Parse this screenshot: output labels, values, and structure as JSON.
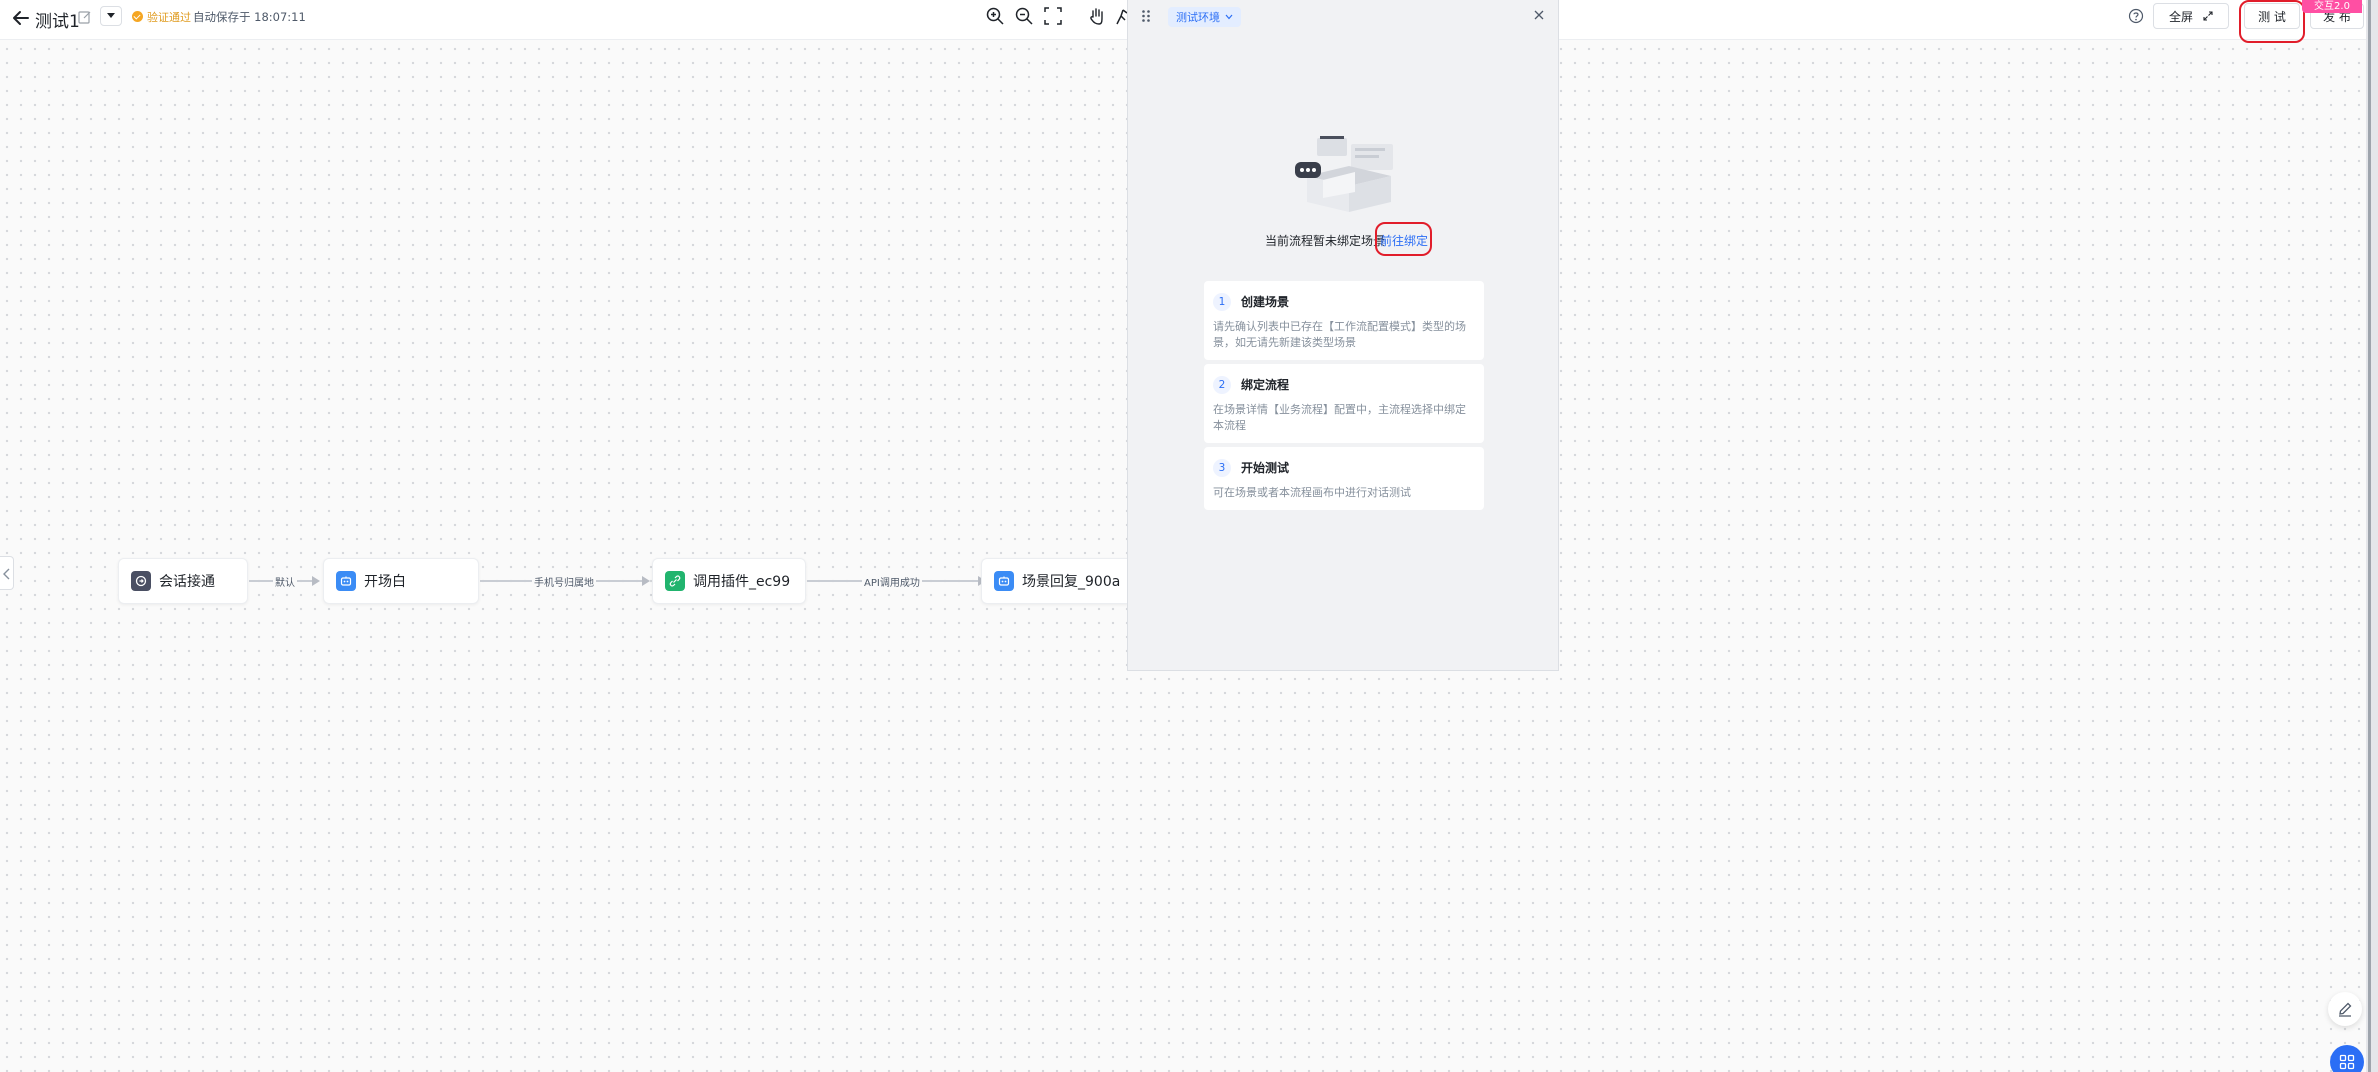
{
  "header": {
    "title": "测试1",
    "validation_status": "验证通过",
    "autosave_text": "自动保存于 18:07:11",
    "fullscreen_label": "全屏",
    "test_label": "测 试",
    "publish_label": "发 布",
    "corner_badge": "交互2.0"
  },
  "toolbar": {
    "icons": [
      "zoom-in-icon",
      "zoom-out-icon",
      "fit-view-icon",
      "hand-icon",
      "run-icon"
    ]
  },
  "flow": {
    "nodes": [
      {
        "label": "会话接通",
        "icon": "session-icon",
        "color": "#4a4f63"
      },
      {
        "label": "开场白",
        "icon": "robot-icon",
        "color": "#3b8cf5"
      },
      {
        "label": "调用插件_ec99",
        "icon": "plugin-icon",
        "color": "#21b46e"
      },
      {
        "label": "场景回复_900a",
        "icon": "robot-icon",
        "color": "#3b8cf5"
      }
    ],
    "edges": [
      {
        "label": "默认"
      },
      {
        "label": "手机号归属地"
      },
      {
        "label": "API调用成功"
      }
    ]
  },
  "test_panel": {
    "env_label": "测试环境",
    "empty_text": "当前流程暂未绑定场景",
    "bind_link": "前往绑定",
    "steps": [
      {
        "num": "1",
        "title": "创建场景",
        "desc": "请先确认列表中已存在【工作流配置模式】类型的场景，如无请先新建该类型场景"
      },
      {
        "num": "2",
        "title": "绑定流程",
        "desc": "在场景详情【业务流程】配置中，主流程选择中绑定本流程"
      },
      {
        "num": "3",
        "title": "开始测试",
        "desc": "可在场景或者本流程画布中进行对话测试"
      }
    ]
  },
  "colors": {
    "primary": "#2b6ef5",
    "highlight": "#e11d2a",
    "warning": "#f5a623"
  }
}
